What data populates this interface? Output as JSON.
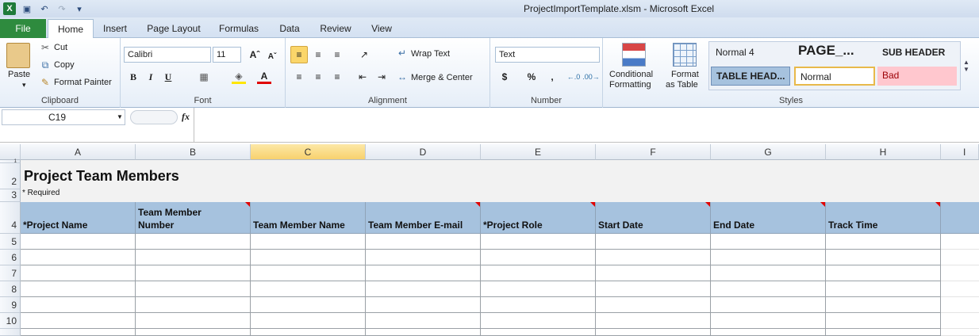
{
  "window": {
    "title": "ProjectImportTemplate.xlsm  -  Microsoft Excel"
  },
  "tabs": [
    "File",
    "Home",
    "Insert",
    "Page Layout",
    "Formulas",
    "Data",
    "Review",
    "View"
  ],
  "clipboard": {
    "paste": "Paste",
    "cut": "Cut",
    "copy": "Copy",
    "format_painter": "Format Painter",
    "label": "Clipboard"
  },
  "font": {
    "name": "Calibri",
    "size": "11",
    "label": "Font",
    "bold": "B",
    "italic": "I",
    "underline": "U"
  },
  "alignment": {
    "wrap_text": "Wrap Text",
    "merge_center": "Merge & Center",
    "label": "Alignment"
  },
  "number": {
    "format": "Text",
    "currency": "$",
    "percent": "%",
    "comma": ",",
    "label": "Number"
  },
  "styles_group": {
    "conditional": "Conditional",
    "formatting": "Formatting",
    "format": "Format",
    "as_table": "as Table",
    "label": "Styles",
    "cells": [
      "Normal 4",
      "PAGE_...",
      "SUB HEADER",
      "TABLE HEAD...",
      "Normal",
      "Bad"
    ]
  },
  "formula_bar": {
    "cell_ref": "C19",
    "fx": "fx",
    "value": ""
  },
  "columns": [
    "A",
    "B",
    "C",
    "D",
    "E",
    "F",
    "G",
    "H",
    "I"
  ],
  "selected_column": "C",
  "rows": [
    "1",
    "2",
    "3",
    "4",
    "5",
    "6",
    "7",
    "8",
    "9",
    "10"
  ],
  "sheet": {
    "title": "Project Team Members",
    "required_note": "* Required",
    "headers": [
      "*Project Name",
      "Team Member Number",
      "Team Member Name",
      "Team Member E-mail",
      "*Project Role",
      "Start Date",
      "End Date",
      "Track Time"
    ],
    "header_lines": [
      [
        "*Project Name"
      ],
      [
        "Team Member",
        "Number"
      ],
      [
        "Team Member Name"
      ],
      [
        "Team Member E-mail"
      ],
      [
        "*Project Role"
      ],
      [
        "Start Date"
      ],
      [
        "End Date"
      ],
      [
        "Track Time"
      ]
    ]
  },
  "colors": {
    "header_fill": "#a6c2de",
    "accent_green": "#2e8b3e",
    "selected_col": "#f8d16d"
  }
}
